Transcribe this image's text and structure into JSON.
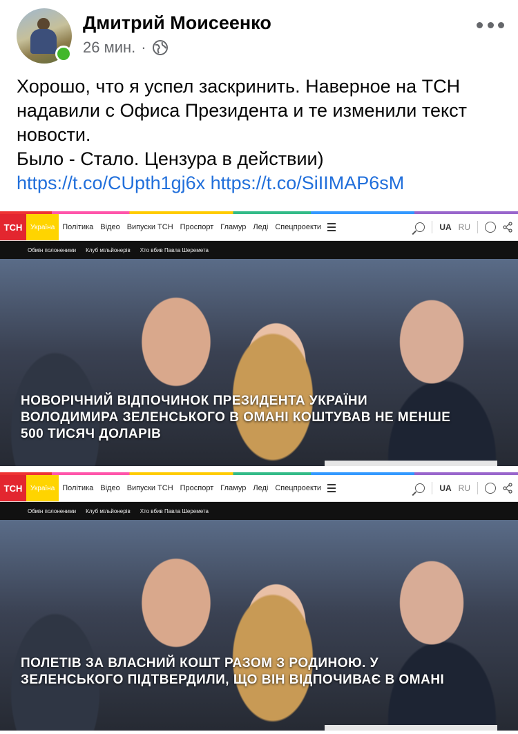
{
  "post": {
    "author": "Дмитрий Моисеенко",
    "time": "26 мин.",
    "separator": "·",
    "privacy_icon": "globe-icon",
    "text_lines": [
      "Хорошо, что я успел заскринить. Наверное на ТСН",
      "надавили с Офиса Президента и те изменили текст",
      "новости.",
      "Было - Стало. Цензура в действии)"
    ],
    "links": [
      "https://t.co/CUpth1gj6x",
      "https://t.co/SiIIMAP6sM"
    ]
  },
  "tsn_nav": {
    "logo": "ТСН",
    "active_tab": "Україна",
    "items": [
      "Політика",
      "Відео",
      "Випуски ТСН",
      "Проспорт",
      "Гламур",
      "Леді",
      "Спецпроекти"
    ],
    "lang_active": "UA",
    "lang_other": "RU",
    "subnav": [
      "Обмін полоненими",
      "Клуб мільйонерів",
      "Хто вбив Павла Шеремета"
    ]
  },
  "shots": [
    {
      "headline": "НОВОРІЧНИЙ ВІДПОЧИНОК ПРЕЗИДЕНТА УКРАЇНИ ВОЛОДИМИРА ЗЕЛЕНСЬКОГО В ОМАНІ КОШТУВАВ НЕ МЕНШЕ 500 ТИСЯЧ ДОЛАРІВ"
    },
    {
      "headline": "ПОЛЕТІВ ЗА ВЛАСНИЙ КОШТ РАЗОМ З РОДИНОЮ. У ЗЕЛЕНСЬКОГО ПІДТВЕРДИЛИ, ЩО ВІН ВІДПОЧИВАЄ В ОМАНІ"
    }
  ],
  "colors": {
    "tsn_red": "#e3262f",
    "tsn_yellow": "#ffd400",
    "link_blue": "#216fdb",
    "online_green": "#42b72a"
  }
}
